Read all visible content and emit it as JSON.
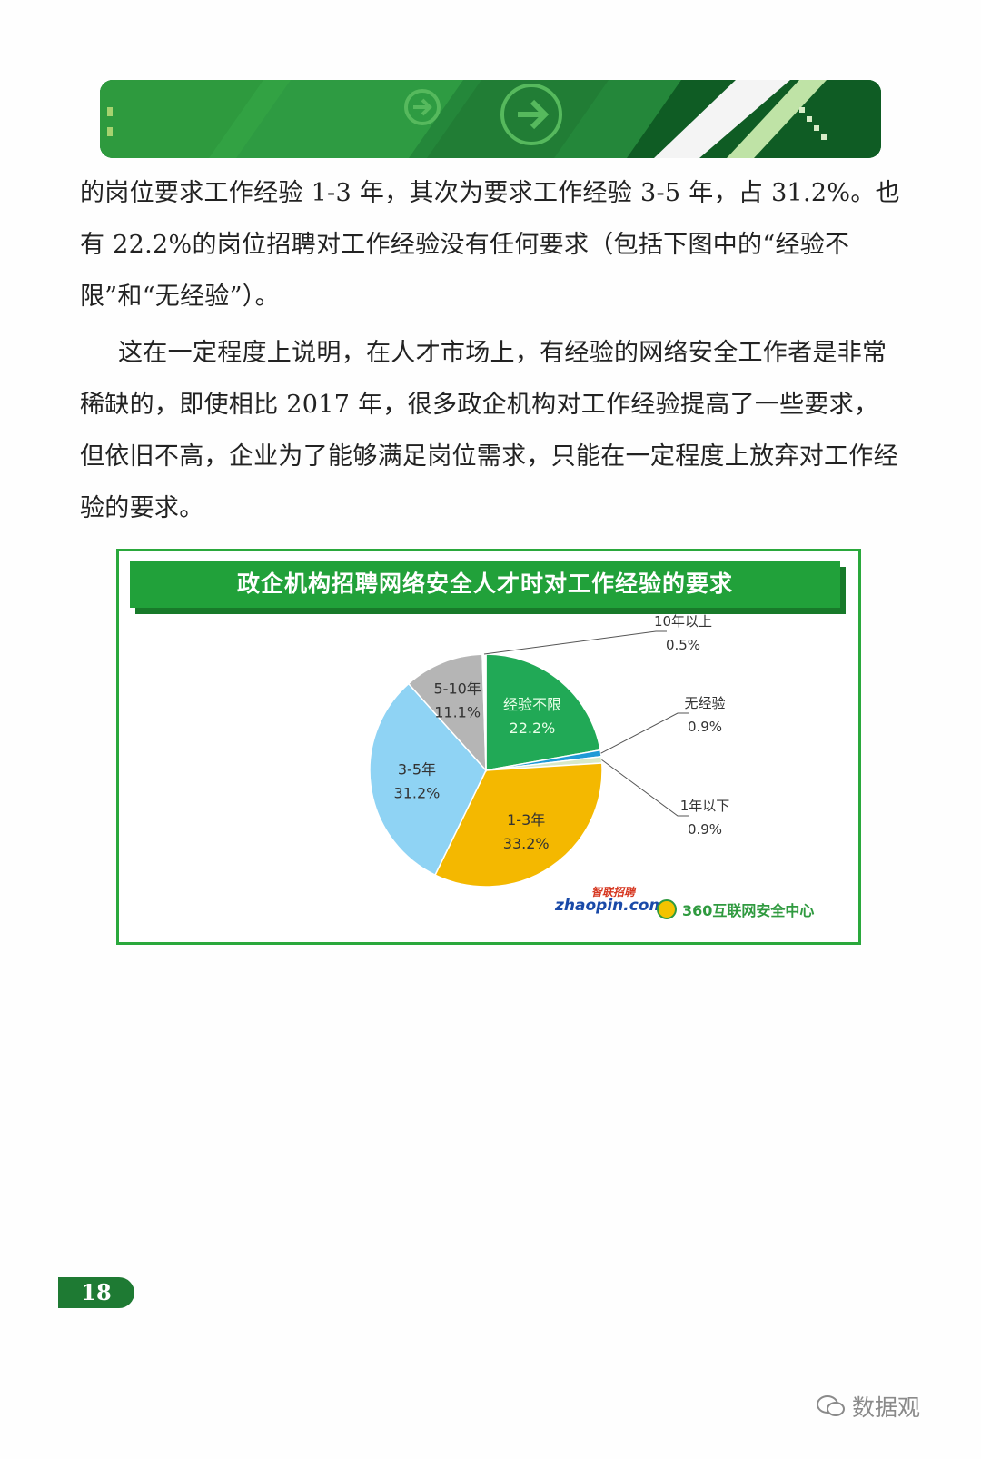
{
  "text": {
    "paragraph1": "的岗位要求工作经验 1-3 年，其次为要求工作经验 3-5 年，占 31.2%。也有 22.2%的岗位招聘对工作经验没有任何要求（包括下图中的“经验不限”和“无经验”）。",
    "paragraph2": "这在一定程度上说明，在人才市场上，有经验的网络安全工作者是非常稀缺的，即使相比 2017 年，很多政企机构对工作经验提高了一些要求，但依旧不高，企业为了能够满足岗位需求，只能在一定程度上放弃对工作经验的要求。"
  },
  "chart_data": {
    "type": "pie",
    "title": "政企机构招聘网络安全人才时对工作经验的要求",
    "slices": [
      {
        "label": "经验不限",
        "value": 22.2,
        "display": "22.2%",
        "color": "#21a956"
      },
      {
        "label": "无经验",
        "value": 0.9,
        "display": "0.9%",
        "color": "#1f9ad6"
      },
      {
        "label": "1年以下",
        "value": 0.9,
        "display": "0.9%",
        "color": "#d8e9c8"
      },
      {
        "label": "1-3年",
        "value": 33.2,
        "display": "33.2%",
        "color": "#f4b800"
      },
      {
        "label": "3-5年",
        "value": 31.2,
        "display": "31.2%",
        "color": "#8fd3f4"
      },
      {
        "label": "5-10年",
        "value": 11.1,
        "display": "11.1%",
        "color": "#b5b5b5"
      },
      {
        "label": "10年以上",
        "value": 0.5,
        "display": "0.5%",
        "color": "#ffffff"
      }
    ]
  },
  "logos": {
    "zhaopin": "zhaopin.com",
    "zhaopin_cn": "智联招聘",
    "security_center": "360互联网安全中心"
  },
  "page_number": "18",
  "watermark": "数据观"
}
